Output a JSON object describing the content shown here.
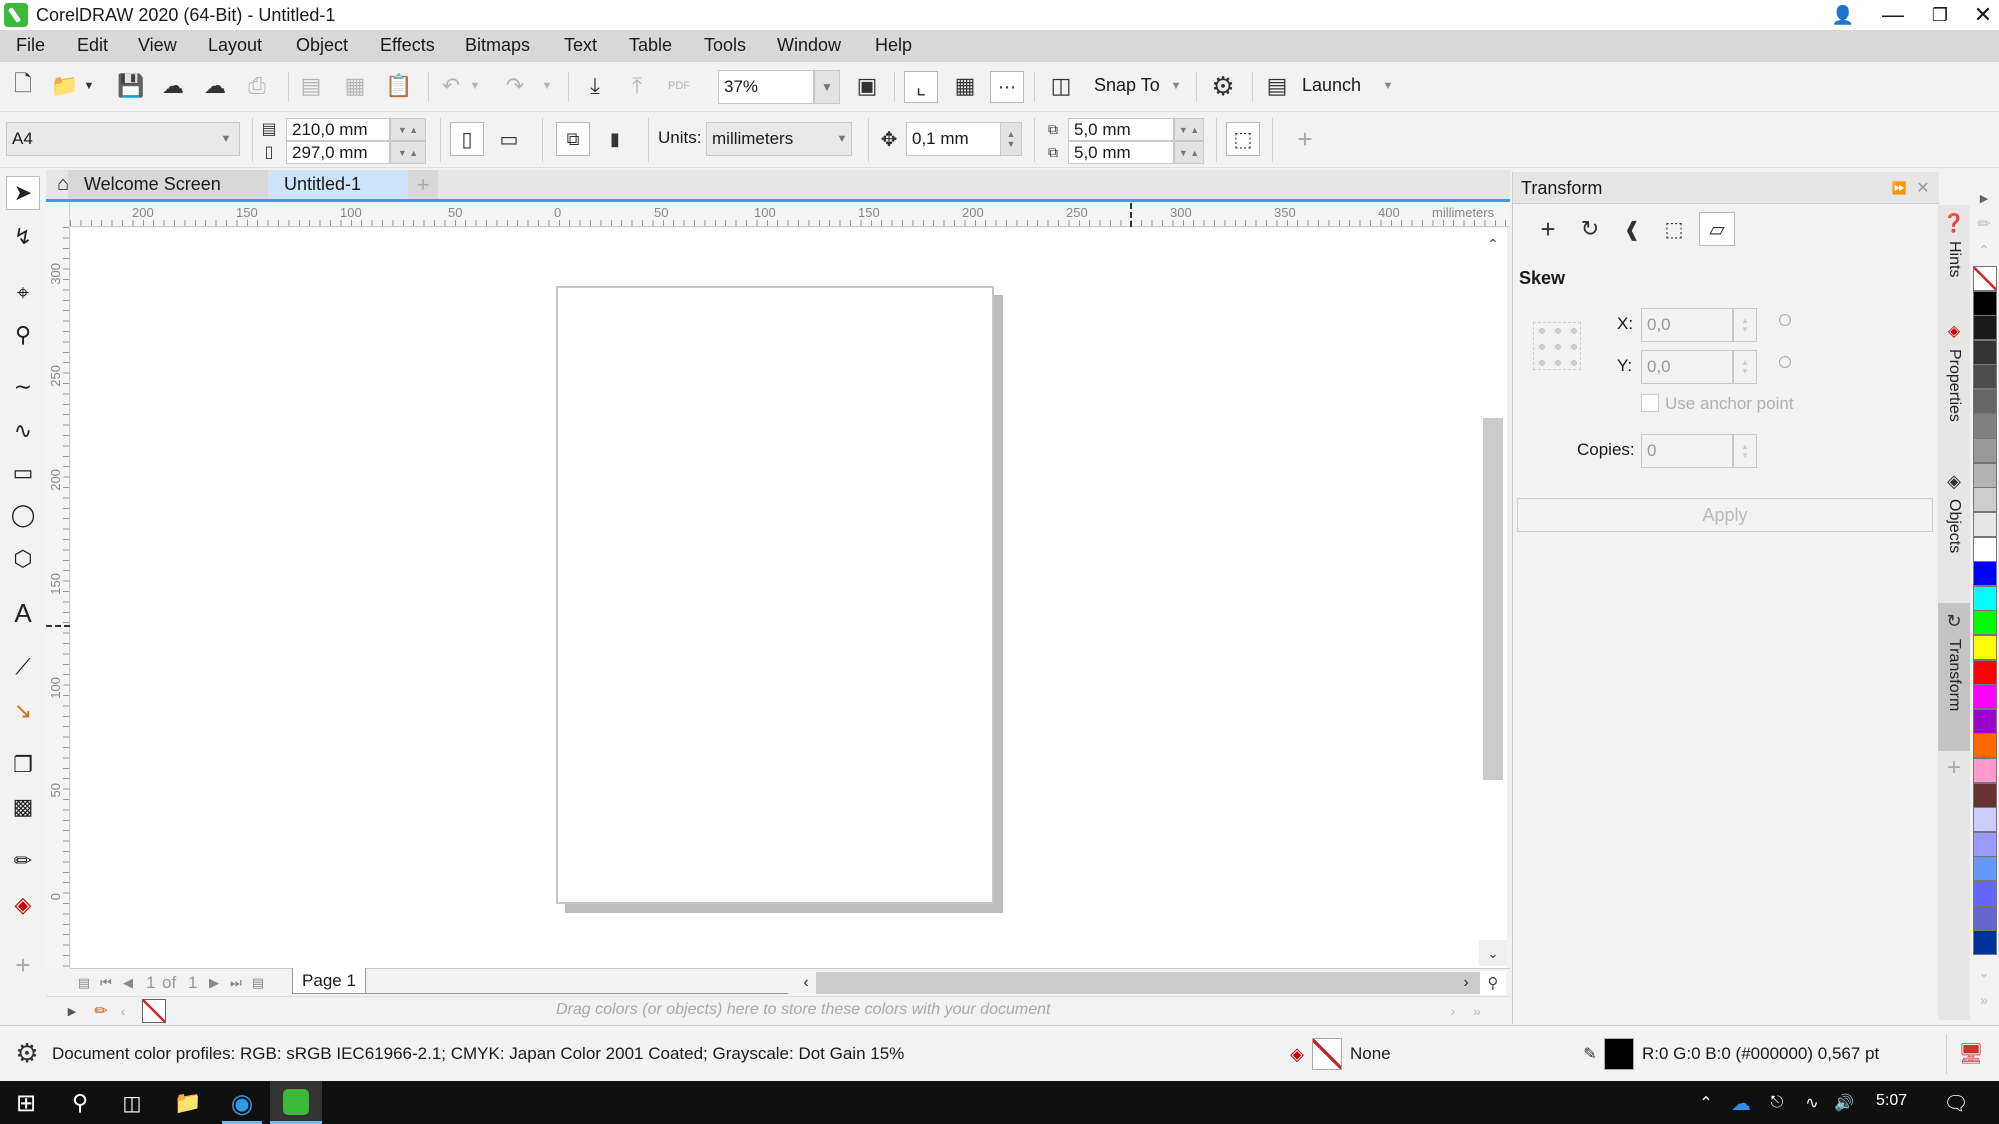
{
  "window": {
    "title": "CorelDRAW 2020 (64-Bit) - Untitled-1",
    "controls": [
      "minimize",
      "restore",
      "close"
    ]
  },
  "menubar": {
    "items": [
      {
        "label": "File",
        "accel": "F"
      },
      {
        "label": "Edit",
        "accel": "E"
      },
      {
        "label": "View",
        "accel": "V"
      },
      {
        "label": "Layout",
        "accel": "L"
      },
      {
        "label": "Object",
        "accel": "j"
      },
      {
        "label": "Effects",
        "accel": "c"
      },
      {
        "label": "Bitmaps",
        "accel": "B"
      },
      {
        "label": "Text",
        "accel": "x"
      },
      {
        "label": "Table",
        "accel": "T"
      },
      {
        "label": "Tools",
        "accel": "o"
      },
      {
        "label": "Window",
        "accel": "W"
      },
      {
        "label": "Help",
        "accel": "H"
      }
    ]
  },
  "standard_toolbar": {
    "zoom_level": "37%",
    "snap_to_label": "Snap To",
    "launch_label": "Launch",
    "pdf_label": "PDF"
  },
  "property_bar": {
    "page_size": "A4",
    "width": "210,0 mm",
    "height": "297,0 mm",
    "units_label": "Units:",
    "units_value": "millimeters",
    "nudge": "0,1 mm",
    "dup_x": "5,0 mm",
    "dup_y": "5,0 mm"
  },
  "tabs": [
    {
      "label": "Welcome Screen",
      "active": false
    },
    {
      "label": "Untitled-1",
      "active": true
    }
  ],
  "rulers": {
    "horizontal_ticks": [
      "200",
      "150",
      "100",
      "50",
      "0",
      "50",
      "100",
      "150",
      "200",
      "250",
      "300",
      "350",
      "400"
    ],
    "unit_label": "millimeters",
    "vertical_ticks": [
      "300",
      "250",
      "200",
      "150",
      "100",
      "50",
      "0"
    ]
  },
  "page_nav": {
    "current": "1",
    "of_label": "of",
    "total": "1",
    "page_tab": "Page 1"
  },
  "doc_palette": {
    "hint": "Drag colors (or objects) here to store these colors with your document"
  },
  "transform_docker": {
    "title": "Transform",
    "section": "Skew",
    "x_label": "X:",
    "x_value": "0,0",
    "y_label": "Y:",
    "y_value": "0,0",
    "anchor_label": "Use anchor point",
    "anchor_checked": false,
    "copies_label": "Copies:",
    "copies_value": "0",
    "apply_label": "Apply"
  },
  "docker_tabs": [
    "Hints",
    "Properties",
    "Objects",
    "Transform"
  ],
  "color_palette": [
    "none",
    "#000000",
    "#1a1a1a",
    "#333333",
    "#4d4d4d",
    "#666666",
    "#808080",
    "#999999",
    "#b3b3b3",
    "#cccccc",
    "#e6e6e6",
    "#ffffff",
    "#0000ff",
    "#00ffff",
    "#00ff00",
    "#ffff00",
    "#ff0000",
    "#ff00ff",
    "#9900cc",
    "#ff6600",
    "#ff99cc",
    "#663333",
    "#ccccff",
    "#9999ff",
    "#6699ff",
    "#6666ff",
    "#6666cc",
    "#003399"
  ],
  "statusbar": {
    "profiles": "Document color profiles: RGB: sRGB IEC61966-2.1; CMYK: Japan Color 2001 Coated; Grayscale: Dot Gain 15%",
    "fill_label": "None",
    "outline_label": "R:0 G:0 B:0 (#000000)  0,567 pt"
  },
  "taskbar": {
    "time": "5:07"
  }
}
